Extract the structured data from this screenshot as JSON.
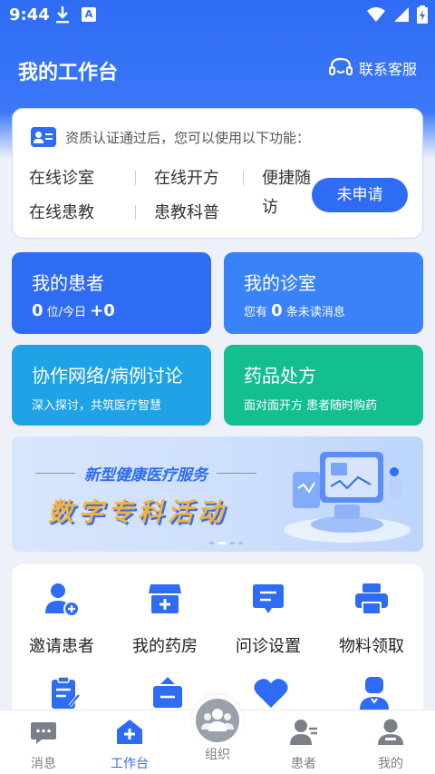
{
  "status_bar": {
    "time": "9:44",
    "a_badge": "A"
  },
  "header": {
    "title": "我的工作台",
    "service_label": "联系客服"
  },
  "qualification": {
    "notice": "资质认证通过后，您可以使用以下功能：",
    "features": [
      "在线诊室",
      "在线开方",
      "便捷随访",
      "在线患教",
      "患教科普"
    ],
    "feature_bianjie_line1": "便捷随",
    "feature_bianjie_line2": "访",
    "apply_label": "未申请"
  },
  "tiles": {
    "patients": {
      "title": "我的患者",
      "count": "0",
      "unit_text": "位/今日",
      "today": "+0",
      "color": "#2f6cf6"
    },
    "clinic": {
      "title": "我的诊室",
      "prefix": "您有",
      "count": "0",
      "suffix": "条未读消息",
      "color": "#3a82f8"
    },
    "collab": {
      "title": "协作网络/病例讨论",
      "sub": "深入探讨，共筑医疗智慧",
      "color": "#1fa3e6"
    },
    "drugs": {
      "title": "药品处方",
      "sub": "面对面开方 患者随时购药",
      "color": "#14bf8f"
    }
  },
  "banner": {
    "line1": "新型健康医疗服务",
    "line2": "数字专科活动"
  },
  "grid": {
    "row1": [
      {
        "label": "邀请患者",
        "icon": "invite-patient-icon"
      },
      {
        "label": "我的药房",
        "icon": "pharmacy-icon"
      },
      {
        "label": "问诊设置",
        "icon": "consult-settings-icon"
      },
      {
        "label": "物料领取",
        "icon": "printer-icon"
      }
    ],
    "row2_icons": [
      "clipboard-icon",
      "briefcase-icon",
      "heart-icon",
      "doctor-icon"
    ]
  },
  "nav": {
    "items": [
      {
        "label": "消息",
        "icon": "message-icon"
      },
      {
        "label": "工作台",
        "icon": "workbench-icon"
      },
      {
        "label": "组织",
        "icon": "organization-icon"
      },
      {
        "label": "患者",
        "icon": "patients-icon"
      },
      {
        "label": "我的",
        "icon": "profile-icon"
      }
    ],
    "active_index": 1
  },
  "colors": {
    "primary": "#2f6cf6",
    "green": "#14bf8f",
    "cyan": "#1fa3e6",
    "banner_yellow": "#f5b33b"
  }
}
